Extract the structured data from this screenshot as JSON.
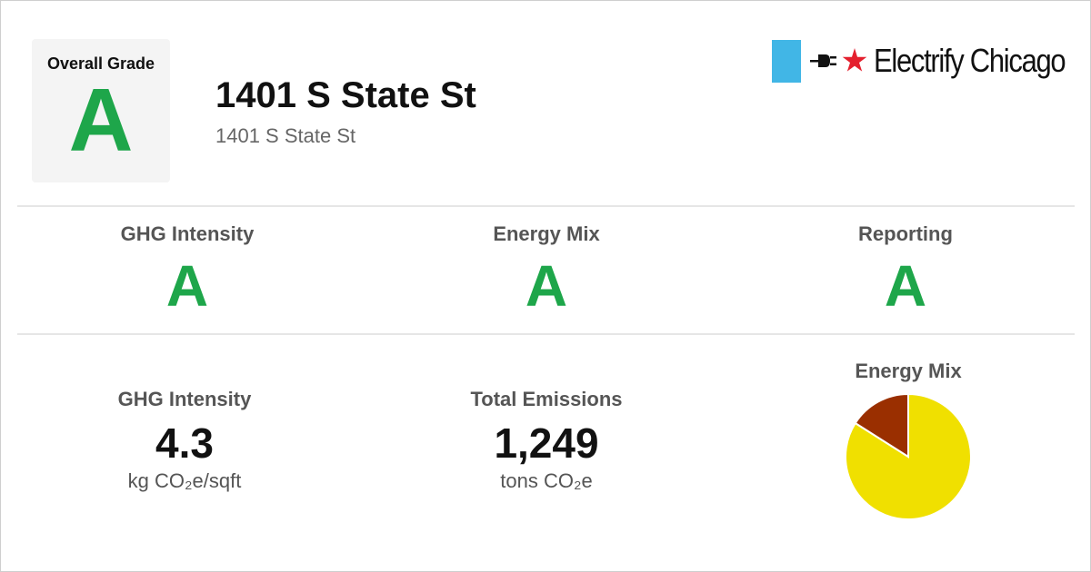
{
  "colors": {
    "grade_a": "#1ea64a",
    "pie_primary": "#f0e000",
    "pie_secondary": "#9a2f00",
    "logo_blue": "#41b6e6",
    "logo_star": "#e4202e"
  },
  "header": {
    "overall_grade_label": "Overall Grade",
    "overall_grade": "A",
    "title": "1401 S State St",
    "subtitle": "1401 S State St",
    "logo_text": "Electrify Chicago",
    "logo_icons": [
      "plug-icon",
      "star-icon"
    ]
  },
  "grades": [
    {
      "label": "GHG Intensity",
      "grade": "A"
    },
    {
      "label": "Energy Mix",
      "grade": "A"
    },
    {
      "label": "Reporting",
      "grade": "A"
    }
  ],
  "metrics": {
    "ghg_intensity": {
      "label": "GHG Intensity",
      "value": "4.3",
      "unit": "kg CO₂e/sqft"
    },
    "total_emissions": {
      "label": "Total Emissions",
      "value": "1,249",
      "unit": "tons CO₂e"
    }
  },
  "energy_mix_chart": {
    "label": "Energy Mix"
  },
  "chart_data": {
    "type": "pie",
    "title": "Energy Mix",
    "values": [
      0.84,
      0.16
    ],
    "colors": [
      "#f0e000",
      "#9a2f00"
    ],
    "start_angle_deg": 0
  }
}
